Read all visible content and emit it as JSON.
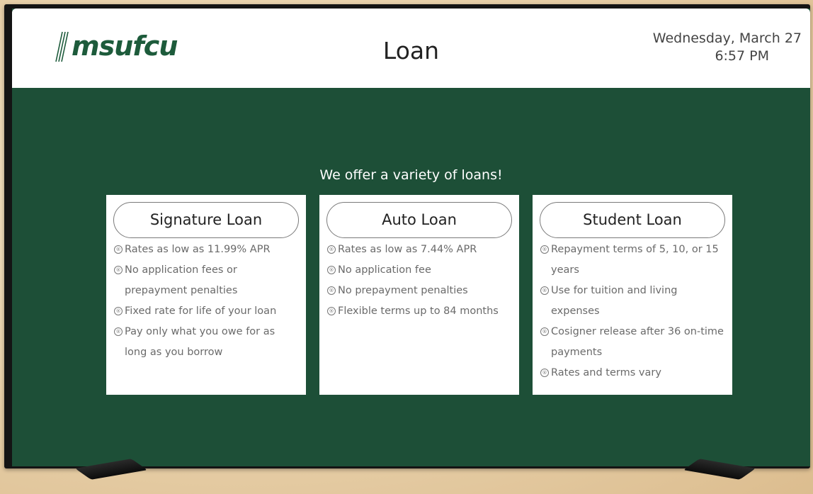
{
  "header": {
    "brand": "msufcu",
    "title": "Loan",
    "date": "Wednesday, March 27",
    "time": "6:57 PM"
  },
  "tagline": "We offer a variety of loans!",
  "cards": [
    {
      "title": "Signature Loan",
      "features": [
        "Rates as low as 11.99% APR",
        "No application fees or prepayment penalties",
        "Fixed rate for life of your loan",
        "Pay only what you owe for as long as you borrow"
      ]
    },
    {
      "title": "Auto Loan",
      "features": [
        "Rates as low as 7.44% APR",
        "No application fee",
        "No prepayment penalties",
        "Flexible terms up to 84 months"
      ]
    },
    {
      "title": "Student Loan",
      "features": [
        "Repayment terms of 5, 10, or 15 years",
        "Use for tuition and living expenses",
        "Cosigner release after 36 on-time payments",
        "Rates and terms vary"
      ]
    }
  ],
  "colors": {
    "screen_bg": "#1d4f37",
    "brand_green": "#1d5b3b",
    "header_bg": "#ffffff"
  },
  "icons": {
    "bullet": "circled-bullet-icon",
    "logo_mark": "msufcu-stripes-logo"
  }
}
